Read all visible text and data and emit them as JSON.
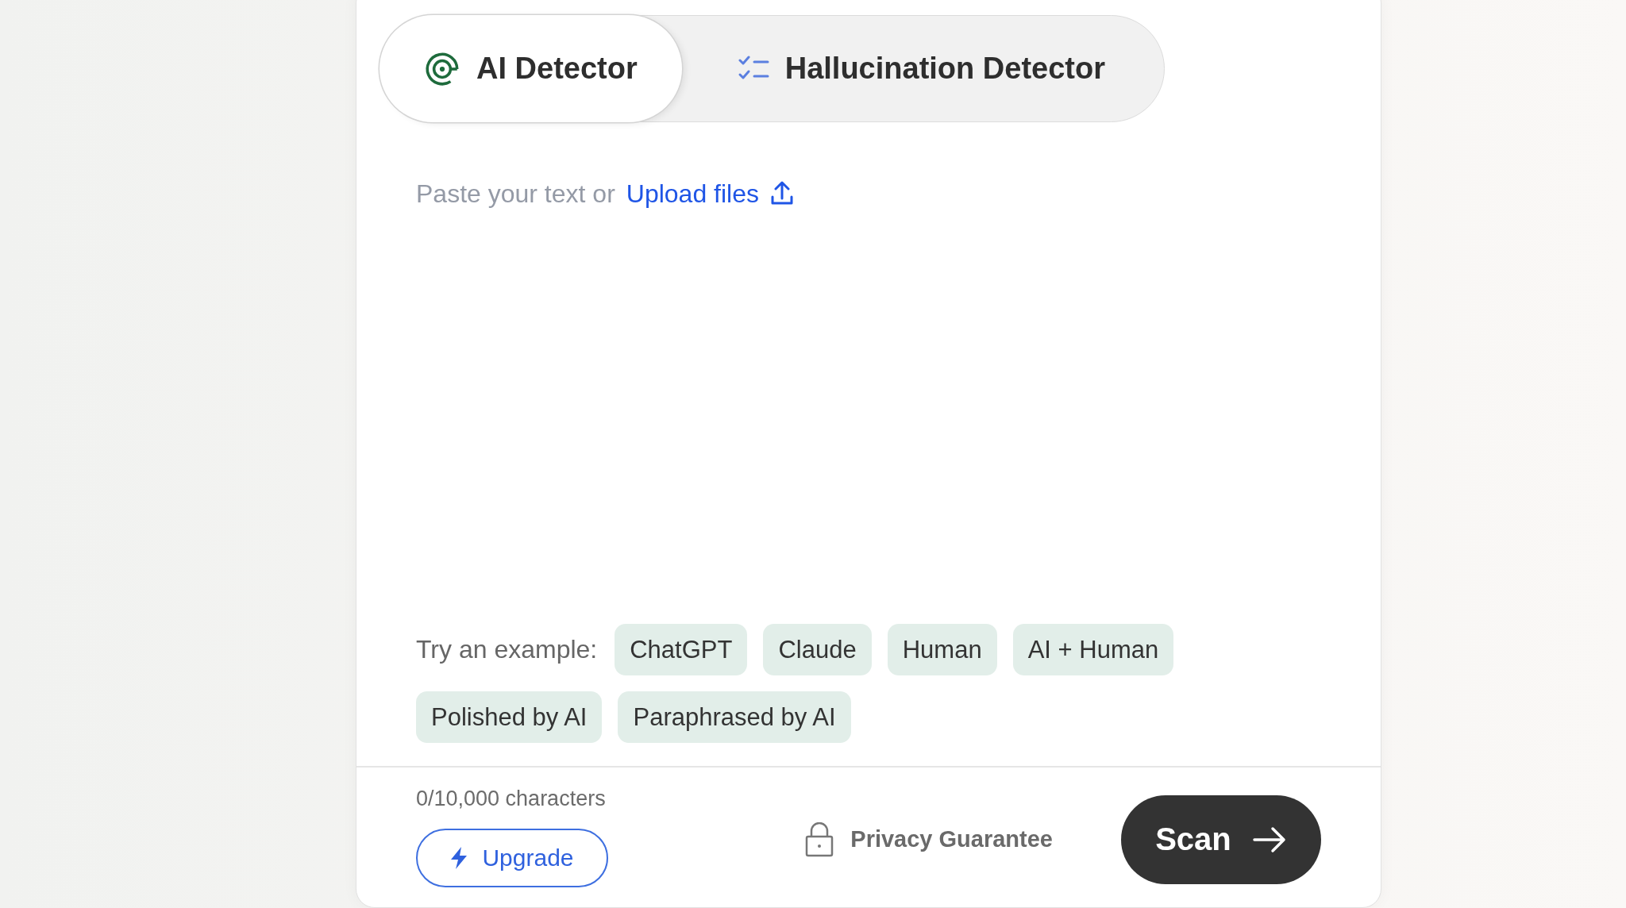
{
  "tabs": [
    {
      "label": "AI Detector",
      "kind": "target",
      "selected": true
    },
    {
      "label": "Hallucination Detector",
      "kind": "checklist",
      "selected": false
    }
  ],
  "editor": {
    "placeholder": "Paste your text or",
    "upload_link": "Upload files"
  },
  "examples": {
    "label": "Try an example:",
    "chips": [
      "ChatGPT",
      "Claude",
      "Human",
      "AI + Human",
      "Polished by AI",
      "Paraphrased by AI"
    ]
  },
  "footer": {
    "char_count": "0/10,000 characters",
    "upgrade_button": "Upgrade",
    "privacy": "Privacy Guarantee",
    "scan_button": "Scan"
  }
}
